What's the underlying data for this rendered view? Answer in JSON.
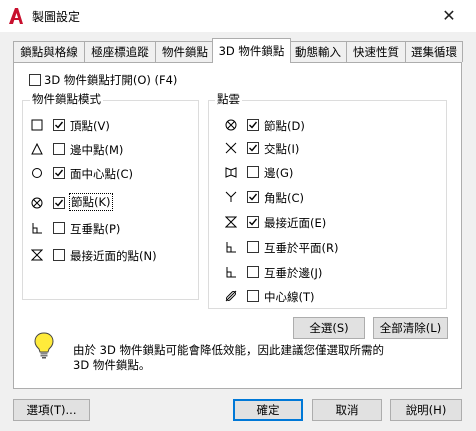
{
  "window": {
    "title": "製圖設定",
    "close_symbol": "✕"
  },
  "tabs": [
    {
      "label": "鎖點與格線"
    },
    {
      "label": "極座標追蹤"
    },
    {
      "label": "物件鎖點"
    },
    {
      "label": "3D 物件鎖點"
    },
    {
      "label": "動態輸入"
    },
    {
      "label": "快速性質"
    },
    {
      "label": "選集循環"
    }
  ],
  "active_tab": "3D 物件鎖點",
  "osnap3d_toggle": {
    "label": "3D 物件鎖點打開(O) (F4)",
    "checked": false
  },
  "object_snap_modes": {
    "title": "物件鎖點模式",
    "items": [
      {
        "symbol": "square-icon",
        "label": "頂點(V)",
        "checked": true
      },
      {
        "symbol": "triangle-icon",
        "label": "邊中點(M)",
        "checked": false
      },
      {
        "symbol": "circle-icon",
        "label": "面中心點(C)",
        "checked": true
      },
      {
        "symbol": "circled-x-icon",
        "label": "節點(K)",
        "checked": true
      },
      {
        "symbol": "perpendicular-icon",
        "label": "互垂點(P)",
        "checked": false
      },
      {
        "symbol": "hourglass-icon",
        "label": "最接近面的點(N)",
        "checked": false
      }
    ]
  },
  "point_cloud": {
    "title": "點雲",
    "items": [
      {
        "symbol": "circled-x-icon",
        "label": "節點(D)",
        "checked": true
      },
      {
        "symbol": "x-icon",
        "label": "交點(I)",
        "checked": true
      },
      {
        "symbol": "edge-icon",
        "label": "邊(G)",
        "checked": false
      },
      {
        "symbol": "y-corner-icon",
        "label": "角點(C)",
        "checked": true
      },
      {
        "symbol": "hourglass-icon",
        "label": "最接近面(E)",
        "checked": true
      },
      {
        "symbol": "perpendicular-icon",
        "label": "互垂於平面(R)",
        "checked": false
      },
      {
        "symbol": "perpendicular-icon",
        "label": "互垂於邊(J)",
        "checked": false
      },
      {
        "symbol": "centerline-icon",
        "label": "中心線(T)",
        "checked": false
      }
    ]
  },
  "select_all_label": "全選(S)",
  "clear_all_label": "全部清除(L)",
  "info": {
    "line1": "由於 3D 物件鎖點可能會降低效能，因此建議您僅選取所需的",
    "line2": "3D 物件鎖點。"
  },
  "buttons": {
    "options": "選項(T)...",
    "ok": "確定",
    "cancel": "取消",
    "help": "說明(H)"
  },
  "colors": {
    "accent": "#0078d7",
    "app_red": "#c8102e"
  }
}
